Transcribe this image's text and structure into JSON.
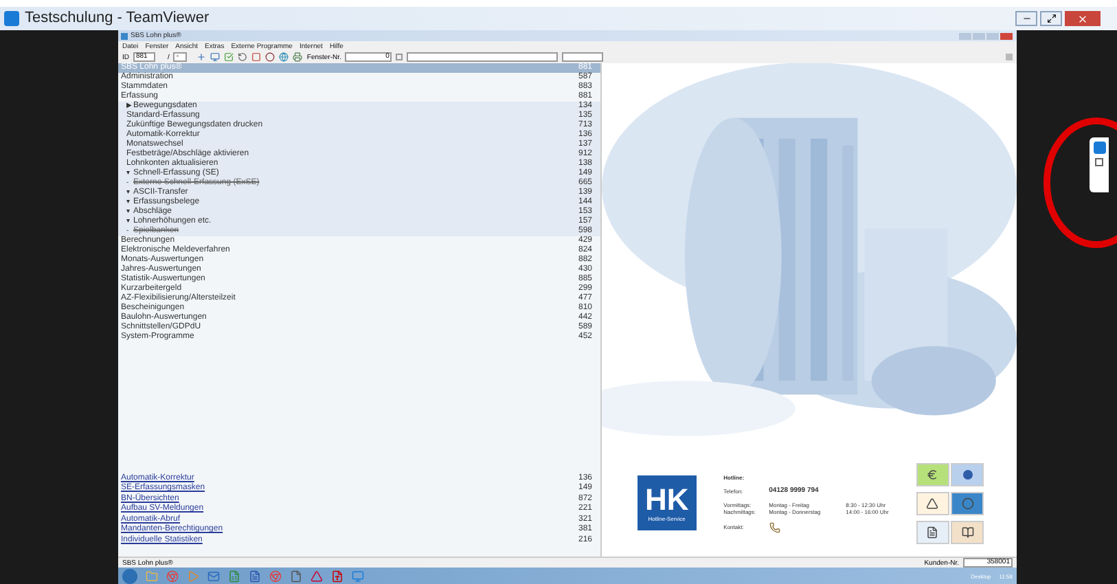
{
  "teamviewer": {
    "title": "Testschulung - TeamViewer"
  },
  "app": {
    "title": "SBS Lohn plus®",
    "menu": [
      "Datei",
      "Fenster",
      "Ansicht",
      "Extras",
      "Externe Programme",
      "Internet",
      "Hilfe"
    ],
    "toolbar": {
      "id_label": "ID",
      "id_value": "881",
      "separator": "/",
      "sub_value": "-",
      "window_label": "Fenster-Nr.",
      "window_value": "0"
    }
  },
  "tree": [
    {
      "label": "SBS Lohn plus®",
      "code": "881",
      "selected": true,
      "disabled": false
    },
    {
      "label": "Administration",
      "code": "587",
      "selected": false,
      "disabled": false
    },
    {
      "label": "Stammdaten",
      "code": "883",
      "selected": false,
      "disabled": false
    },
    {
      "label": "Erfassung",
      "code": "881",
      "selected": false,
      "disabled": false,
      "children": [
        {
          "marker": "▶",
          "label": "Bewegungsdaten",
          "code": "134",
          "selected": false,
          "disabled": false
        },
        {
          "label": "Standard-Erfassung",
          "code": "135",
          "selected": false,
          "disabled": false
        },
        {
          "label": "Zukünftige Bewegungsdaten drucken",
          "code": "713",
          "selected": false,
          "disabled": false
        },
        {
          "label": "Automatik-Korrektur",
          "code": "136",
          "selected": false,
          "disabled": false
        },
        {
          "label": "Monatswechsel",
          "code": "137",
          "selected": false,
          "disabled": false
        },
        {
          "label": "Festbeträge/Abschläge aktivieren",
          "code": "912",
          "selected": false,
          "disabled": false
        },
        {
          "label": "Lohnkonten aktualisieren",
          "code": "138",
          "selected": false,
          "disabled": false
        },
        {
          "marker": "▾",
          "label": "Schnell-Erfassung (SE)",
          "code": "149",
          "selected": false,
          "disabled": false
        },
        {
          "marker": "-",
          "label": "Externe Schnell-Erfassung (ExSE)",
          "code": "665",
          "selected": false,
          "disabled": true
        },
        {
          "marker": "▾",
          "label": "ASCII-Transfer",
          "code": "139",
          "selected": false,
          "disabled": false
        },
        {
          "marker": "▾",
          "label": "Erfassungsbelege",
          "code": "144",
          "selected": false,
          "disabled": false
        },
        {
          "marker": "▾",
          "label": "Abschläge",
          "code": "153",
          "selected": false,
          "disabled": false
        },
        {
          "marker": "▾",
          "label": "Lohnerhöhungen etc.",
          "code": "157",
          "selected": false,
          "disabled": false
        },
        {
          "marker": "-",
          "label": "Spielbanken",
          "code": "598",
          "selected": false,
          "disabled": true
        }
      ]
    },
    {
      "label": "Berechnungen",
      "code": "429",
      "selected": false,
      "disabled": false
    },
    {
      "label": "Elektronische Meldeverfahren",
      "code": "824",
      "selected": false,
      "disabled": false
    },
    {
      "label": "Monats-Auswertungen",
      "code": "882",
      "selected": false,
      "disabled": false
    },
    {
      "label": "Jahres-Auswertungen",
      "code": "430",
      "selected": false,
      "disabled": false
    },
    {
      "label": "Statistik-Auswertungen",
      "code": "885",
      "selected": false,
      "disabled": false
    },
    {
      "label": "Kurzarbeitergeld",
      "code": "299",
      "selected": false,
      "disabled": false
    },
    {
      "label": "AZ-Flexibilisierung/Altersteilzeit",
      "code": "477",
      "selected": false,
      "disabled": false
    },
    {
      "label": "Bescheinigungen",
      "code": "810",
      "selected": false,
      "disabled": false
    },
    {
      "label": "Baulohn-Auswertungen",
      "code": "442",
      "selected": false,
      "disabled": false
    },
    {
      "label": "Schnittstellen/GDPdU",
      "code": "589",
      "selected": false,
      "disabled": false
    },
    {
      "label": "System-Programme",
      "code": "452",
      "selected": false,
      "disabled": false
    }
  ],
  "quick_links": [
    {
      "label": "Automatik-Korrektur",
      "code": "136"
    },
    {
      "label": "SE-Erfassungsmasken",
      "code": "149"
    },
    {
      "label": "BN-Übersichten",
      "code": "872"
    },
    {
      "label": "Aufbau SV-Meldungen",
      "code": "221"
    },
    {
      "label": "Automatik-Abruf",
      "code": "321"
    },
    {
      "label": "Mandanten-Berechtigungen",
      "code": "381"
    },
    {
      "label": "Individuelle Statistiken",
      "code": "216"
    }
  ],
  "hotline": {
    "logo_text": "HK",
    "logo_caption": "Hotline-Service",
    "title": "Hotline:",
    "phone_label": "Telefon:",
    "phone": "04128 9999 794",
    "hours": [
      {
        "label": "Vormittags:",
        "days": "Montag - Freitag",
        "time": "8:30 - 12:30 Uhr"
      },
      {
        "label": "Nachmittags:",
        "days": "Montag - Donnerstag",
        "time": "14:00 - 16:00 Uhr"
      }
    ],
    "contact_label": "Kontakt:"
  },
  "status_bar": {
    "app_name": "SBS Lohn plus®",
    "customer_label": "Kunden-Nr.",
    "customer_value": "358001"
  },
  "taskbar": {
    "desktop_label": "Desktop",
    "time": "11:58"
  }
}
